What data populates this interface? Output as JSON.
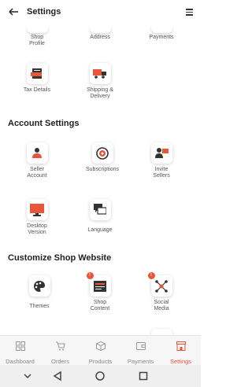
{
  "header": {
    "title": "Settings"
  },
  "top_row": [
    {
      "label": "Shop Profile"
    },
    {
      "label": "Address"
    },
    {
      "label": "Payments"
    }
  ],
  "row2": [
    {
      "label": "Tax Details"
    },
    {
      "label": "Shipping & Delivery"
    }
  ],
  "account_settings": {
    "heading": "Account Settings",
    "items": [
      {
        "label": "Seller Account"
      },
      {
        "label": "Subscriptions"
      },
      {
        "label": "Invite Sellers"
      },
      {
        "label": "Desktop Version"
      },
      {
        "label": "Language"
      }
    ]
  },
  "customize": {
    "heading": "Customize Shop Website",
    "items": [
      {
        "label": "Themes",
        "badge": ""
      },
      {
        "label": "Shop Content",
        "badge": "!"
      },
      {
        "label": "Social Media",
        "badge": "!"
      }
    ]
  },
  "bottom_nav": {
    "items": [
      {
        "label": "Dashboard",
        "icon": "dashboard-icon"
      },
      {
        "label": "Orders",
        "icon": "cart-icon"
      },
      {
        "label": "Products",
        "icon": "box-icon"
      },
      {
        "label": "Payments",
        "icon": "wallet-icon"
      },
      {
        "label": "Settings",
        "icon": "store-icon"
      }
    ],
    "active": "Settings"
  },
  "colors": {
    "accent": "#e7553a",
    "icon_dark": "#333333"
  }
}
